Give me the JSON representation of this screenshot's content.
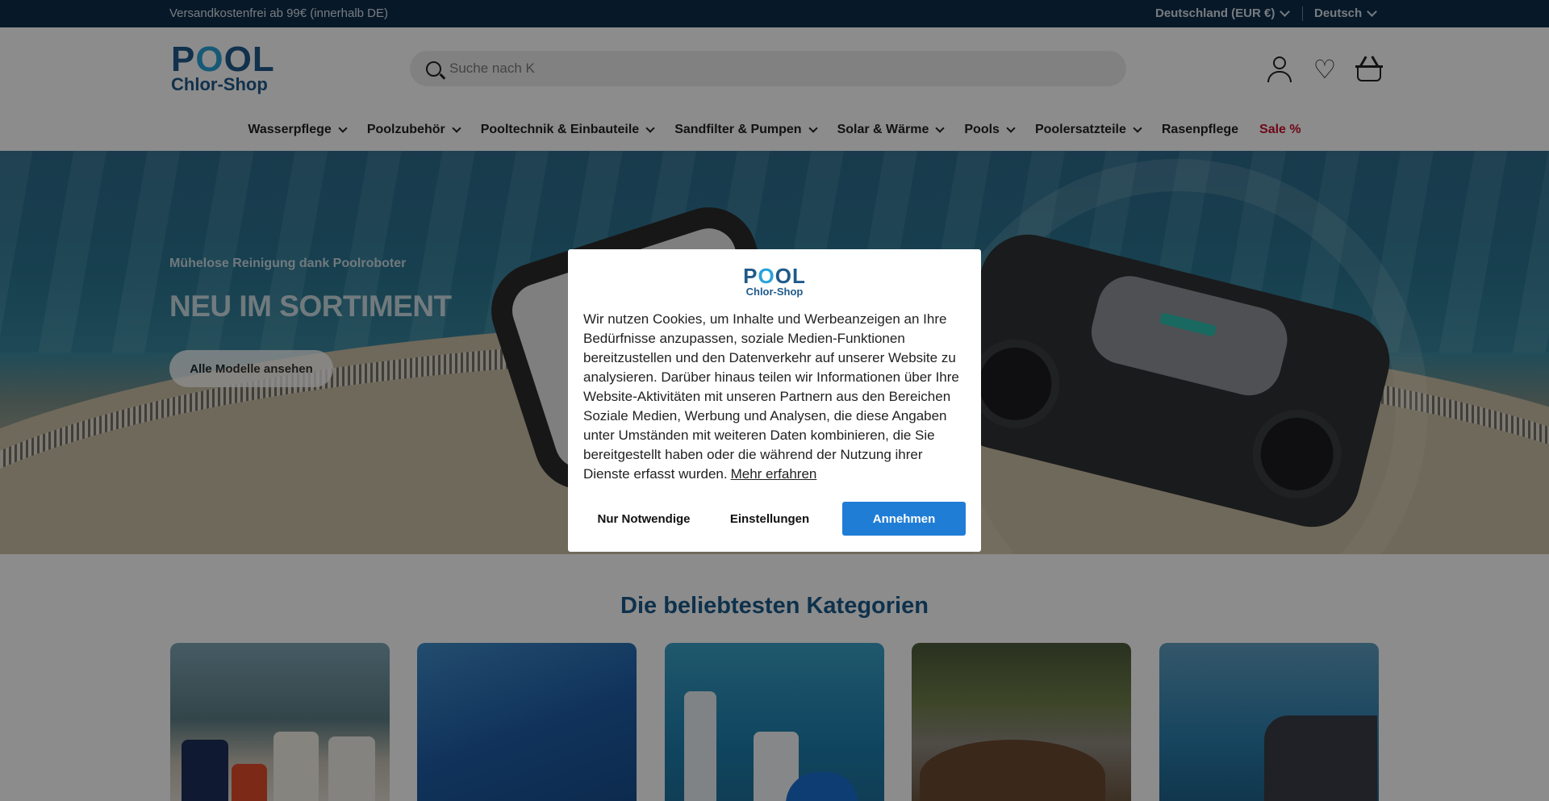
{
  "topbar": {
    "shipping": "Versandkostenfrei ab 99€ (innerhalb DE)",
    "country": "Deutschland (EUR €)",
    "language": "Deutsch"
  },
  "header": {
    "logo_line1_a": "P",
    "logo_line1_o": "O",
    "logo_line1_b": "OL",
    "logo_line2": "Chlor-Shop",
    "search_placeholder": "Suche nach K",
    "icons": [
      "account-icon",
      "heart-icon",
      "basket-icon"
    ]
  },
  "nav": {
    "items": [
      {
        "label": "Wasserpflege"
      },
      {
        "label": "Poolzubehör"
      },
      {
        "label": "Pooltechnik & Einbauteile"
      },
      {
        "label": "Sandfilter & Pumpen"
      },
      {
        "label": "Solar & Wärme"
      },
      {
        "label": "Pools"
      },
      {
        "label": "Poolersatzteile"
      },
      {
        "label": "Rasenpflege"
      },
      {
        "label": "Sale %"
      }
    ],
    "sale_color": "#c8102e"
  },
  "hero": {
    "kicker": "Mühelose Reinigung dank Poolroboter",
    "headline": "NEU IM SORTIMENT",
    "cta": "Alle Modelle ansehen"
  },
  "categories": {
    "title": "Die beliebtesten Kategorien",
    "title_color": "#1a5a8a"
  },
  "cookie": {
    "logo_line1_a": "P",
    "logo_line1_o": "O",
    "logo_line1_b": "OL",
    "logo_line2": "Chlor-Shop",
    "text": "Wir nutzen Cookies, um Inhalte und Werbeanzeigen an Ihre Bedürfnisse anzupassen, soziale Medien-Funktionen bereitzustellen und den Datenverkehr auf unserer Website zu analysieren. Darüber hinaus teilen wir Informationen über Ihre Website-Aktivitäten mit unseren Partnern aus den Bereichen Soziale Medien, Werbung und Analysen, die diese Angaben unter Umständen mit weiteren Daten kombinieren, die Sie bereitgestellt haben oder die während der Nutzung ihrer Dienste erfasst wurden.",
    "learn_more": "Mehr erfahren",
    "btn_necessary": "Nur Notwendige",
    "btn_settings": "Einstellungen",
    "btn_accept": "Annehmen",
    "accept_color": "#1f7dd6"
  }
}
